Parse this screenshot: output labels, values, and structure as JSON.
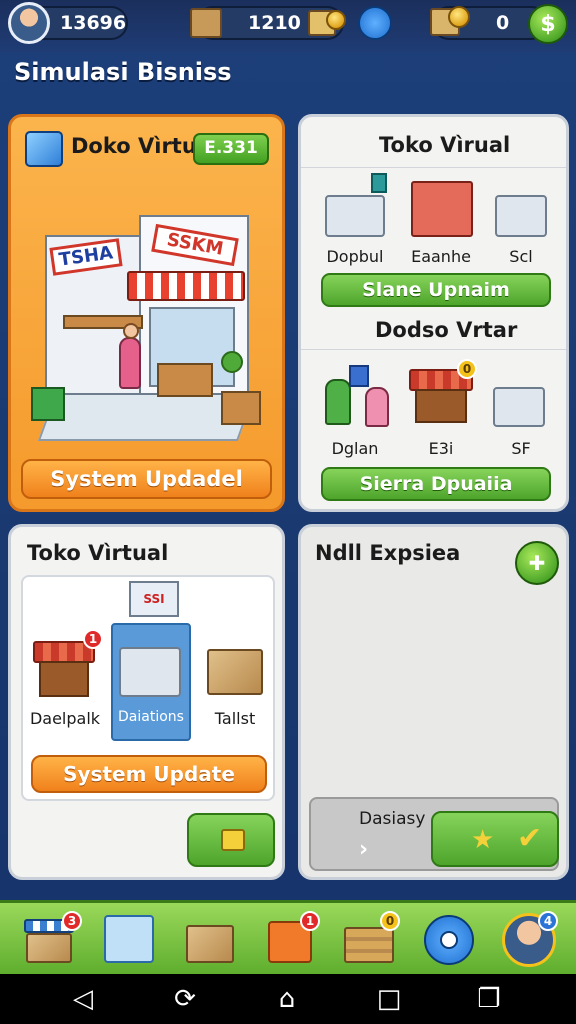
{
  "top_bar": {
    "player_coins": "13696",
    "resource_count": "1210",
    "gold_count": "0"
  },
  "page_title": "Simulasi Bisniss",
  "panel_store": {
    "title": "Doko Vìrtual",
    "tag": "E.331",
    "sign_left": "TSHA",
    "sign_right": "SSKM",
    "button": "System Updadel"
  },
  "panel_toko": {
    "title": "Toko Vìrual",
    "items": [
      "Dopbul",
      "Eaanhe",
      "Scl"
    ],
    "button_1": "Slane Upnaim",
    "subtitle": "Dodso Vrtar",
    "items_2": [
      "Dglan",
      "E3i",
      "SF"
    ],
    "badge_count": "0",
    "button_2": "Sierra Dpuaiia"
  },
  "panel_toko_bottom": {
    "title": "Toko Vìrtual",
    "sign": "SSI",
    "items": [
      "Daelpalk",
      "Daiations",
      "Tallst"
    ],
    "badge_count": "1",
    "button": "System Update"
  },
  "panel_expense": {
    "title": "Ndll Expsiea",
    "card_label": "Dasiasy"
  },
  "bottom_nav": {
    "badge_1": "3",
    "badge_4": "1",
    "badge_5": "0",
    "badge_7": "4"
  },
  "colors": {
    "background": "#1a3a72",
    "orange_panel": "#f59a2c",
    "green_button": "#4ea52c",
    "orange_button": "#f0811c"
  }
}
